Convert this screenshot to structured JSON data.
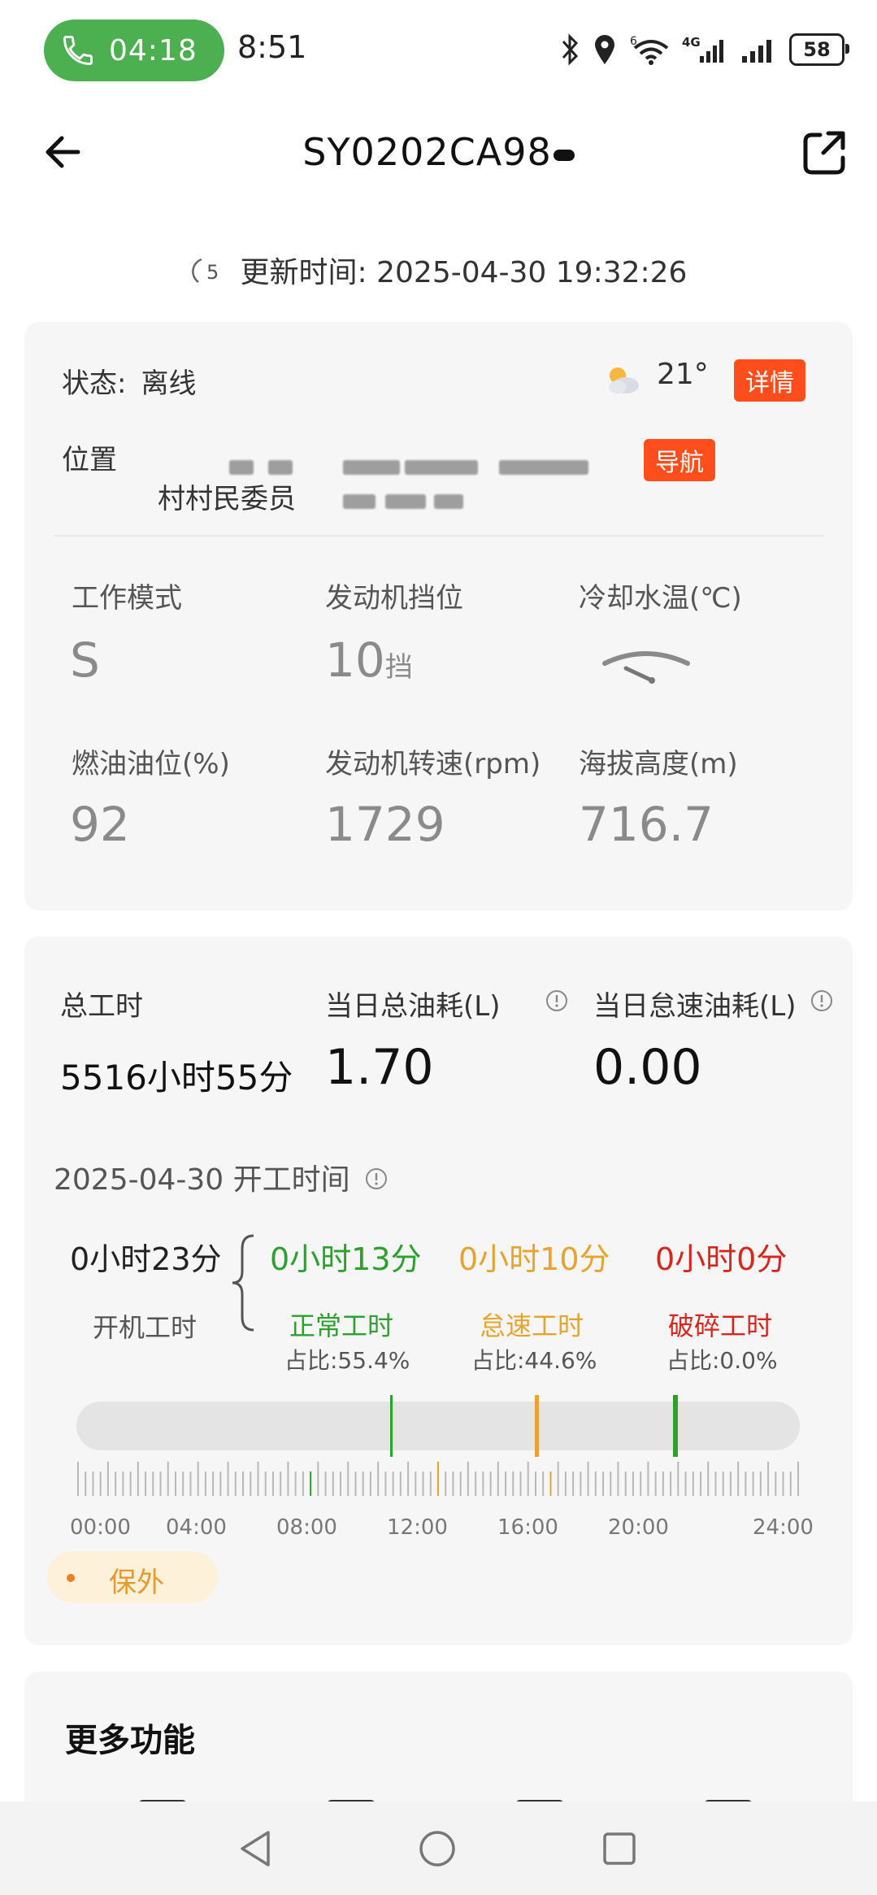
{
  "status_bar": {
    "call_timer": "04:18",
    "time": "8:51",
    "network_label": "4G",
    "wifi_badge": "6",
    "battery": "58"
  },
  "header": {
    "title": "SY0202CA98"
  },
  "update": {
    "refresh_count": "5",
    "text": "更新时间: 2025-04-30 19:32:26"
  },
  "status_card": {
    "status_label": "状态:",
    "status_value": "离线",
    "temperature": "21°",
    "detail_button": "详情",
    "location_label": "位置",
    "location_line2": "村村民委员",
    "nav_button": "导航",
    "metrics": [
      {
        "label": "工作模式",
        "value": "S",
        "unit": ""
      },
      {
        "label": "发动机挡位",
        "value": "10",
        "unit": "挡"
      },
      {
        "label": "冷却水温(℃)",
        "value": "",
        "unit": ""
      },
      {
        "label": "燃油油位(%)",
        "value": "92",
        "unit": ""
      },
      {
        "label": "发动机转速(rpm)",
        "value": "1729",
        "unit": ""
      },
      {
        "label": "海拔高度(m)",
        "value": "716.7",
        "unit": ""
      }
    ]
  },
  "work_card": {
    "total_hours_label": "总工时",
    "total_hours_value": "5516小时55分",
    "fuel_label": "当日总油耗(L)",
    "fuel_value": "1.70",
    "idle_fuel_label": "当日怠速油耗(L)",
    "idle_fuel_value": "0.00",
    "date_title": "2025-04-30 开工时间",
    "boot_time": "0小时23分",
    "boot_label": "开机工时",
    "segments": [
      {
        "time": "0小时13分",
        "name": "正常工时",
        "pct": "占比:55.4%",
        "color": "#2ea02e"
      },
      {
        "time": "0小时10分",
        "name": "怠速工时",
        "pct": "占比:44.6%",
        "color": "#e6a42e"
      },
      {
        "time": "0小时0分",
        "name": "破碎工时",
        "pct": "占比:0.0%",
        "color": "#d9261c"
      }
    ],
    "hours": [
      "00:00",
      "04:00",
      "08:00",
      "12:00",
      "16:00",
      "20:00",
      "24:00"
    ],
    "warranty": "保外"
  },
  "more": {
    "title": "更多功能"
  },
  "colors": {
    "accent_orange": "#ff4d1c",
    "call_green": "#4caf50"
  }
}
